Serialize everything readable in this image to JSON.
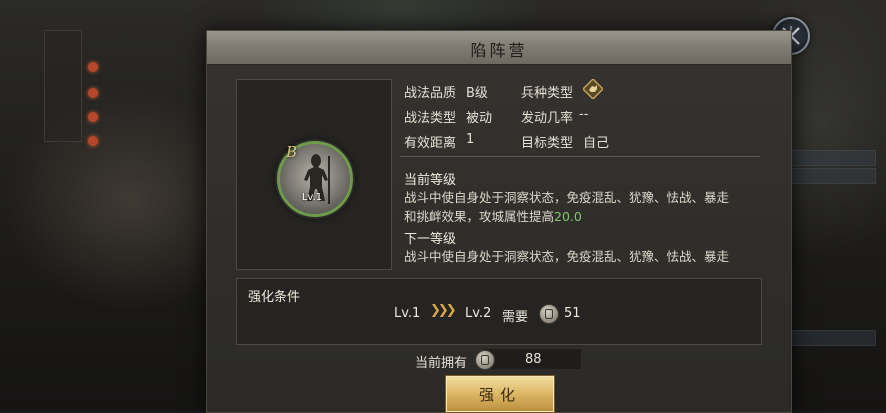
{
  "dialog": {
    "title": "陷阵营",
    "portrait": {
      "grade": "B",
      "level": "Lv.1"
    },
    "info": {
      "quality_label": "战法品质",
      "quality_value": "B级",
      "troop_label": "兵种类型",
      "type_label": "战法类型",
      "type_value": "被动",
      "rate_label": "发动几率",
      "rate_value": "--",
      "range_label": "有效距离",
      "range_value": "1",
      "target_label": "目标类型",
      "target_value": "自己"
    },
    "current_level": {
      "heading": "当前等级",
      "line1": "战斗中使自身处于洞察状态，免疫混乱、犹豫、怯战、暴走",
      "line2_prefix": "和挑衅效果，攻城属性提高",
      "line2_value": "20.0"
    },
    "next_level": {
      "heading": "下一等级",
      "line1": "战斗中使自身处于洞察状态，免疫混乱、犹豫、怯战、暴走"
    },
    "enhance_condition": {
      "title": "强化条件",
      "from_level": "Lv.1",
      "to_level": "Lv.2",
      "require_label": "需要",
      "require_amount": "51"
    },
    "owned": {
      "label": "当前拥有",
      "amount": "88"
    },
    "enhance_button": "强化"
  },
  "colors": {
    "accent_gold": "#dcb664",
    "highlight_green": "#7fc86a",
    "ring_green": "#6d9b4a"
  },
  "icons": [
    "close-icon",
    "troop-type-icon",
    "arrow-icon",
    "tactic-point-icon"
  ]
}
